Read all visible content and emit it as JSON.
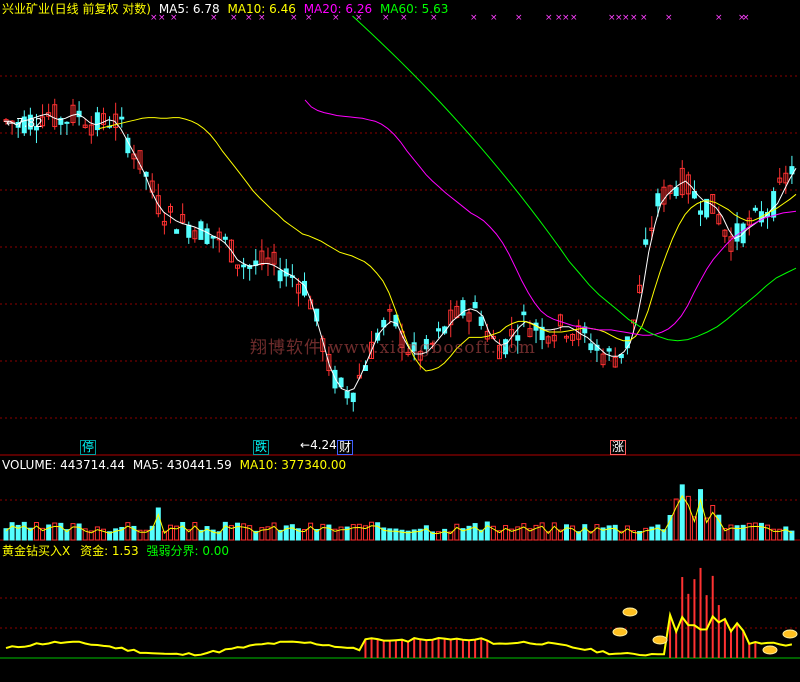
{
  "header": {
    "stock_name": "兴业矿业(日线 前复权 对数)",
    "ma": [
      {
        "text": "MA5: 6.78",
        "color": "#ffffff"
      },
      {
        "text": "MA10: 6.46",
        "color": "#ffff00"
      },
      {
        "text": "MA20: 6.26",
        "color": "#ff00ff"
      },
      {
        "text": "MA60: 5.63",
        "color": "#00ff00"
      }
    ]
  },
  "volume_header": {
    "volume": "VOLUME: 443714.44",
    "ma5": "MA5: 430441.59",
    "ma10": "MA10: 377340.00"
  },
  "indicator_header": {
    "name": "黄金钻买入X",
    "fund": "资金: 1.53",
    "boundary": "强弱分界: 0.00"
  },
  "annotations": {
    "high_label": "7.82",
    "low_label": "4.24",
    "event_ting": "停",
    "event_die": "跌",
    "event_cai": "财",
    "event_zhang": "涨"
  },
  "watermark": "翔博软件 www.xiangbosoft.com",
  "colors": {
    "up": "#ff3232",
    "down": "#54ffff",
    "ma5": "#ffffff",
    "ma10": "#ffff00",
    "ma20": "#ff00ff",
    "ma60": "#00ff00",
    "grid": "#8b0000",
    "indicator": "#ffff00",
    "boundary": "#00c000"
  },
  "chart_data": {
    "type": "candlestick",
    "scale": "log",
    "ylim": [
      4.0,
      9.0
    ],
    "series": [
      {
        "name": "MA5",
        "values": [
          7.4,
          7.4,
          7.35,
          7.4,
          7.42,
          7.45,
          7.48,
          7.5,
          7.45,
          7.42,
          7.44,
          7.48,
          7.5,
          7.45,
          7.38,
          7.35,
          7.38,
          7.42,
          7.4,
          7.3,
          7.15,
          7.0,
          6.85,
          6.7,
          6.5,
          6.35,
          6.25,
          6.2,
          6.15,
          6.12,
          6.1,
          6.08,
          6.05,
          6.02,
          5.98,
          5.95,
          5.9,
          5.82,
          5.72,
          5.68,
          5.65,
          5.66,
          5.68,
          5.68,
          5.66,
          5.62,
          5.58,
          5.55,
          5.5,
          5.45,
          5.3,
          5.1,
          4.9,
          4.7,
          4.58,
          4.5,
          4.48,
          4.5,
          4.6,
          4.72,
          4.85,
          4.98,
          5.05,
          5.1,
          5.08,
          4.95,
          4.85,
          4.8,
          4.8,
          4.82,
          4.88,
          4.95,
          5.02,
          5.1,
          5.15,
          5.2,
          5.22,
          5.2,
          5.15,
          5.0,
          4.92,
          4.88,
          4.9,
          4.98,
          5.05,
          5.1,
          5.08,
          5.05,
          5.02,
          5.02,
          5.03,
          5.05,
          5.05,
          5.02,
          4.98,
          4.95,
          4.9,
          4.85,
          4.8,
          4.78,
          4.78,
          4.82,
          4.9,
          5.1,
          5.4,
          5.8,
          6.1,
          6.35,
          6.45,
          6.52,
          6.58,
          6.62,
          6.55,
          6.45,
          6.38,
          6.35,
          6.3,
          6.2,
          6.05,
          5.95,
          5.98,
          6.05,
          6.1,
          6.15,
          6.2,
          6.28,
          6.35,
          6.5,
          6.65,
          6.78
        ]
      },
      {
        "name": "MA10",
        "values": [
          7.3,
          7.32,
          7.34,
          7.36,
          7.38,
          7.4,
          7.42,
          7.44,
          7.45,
          7.45,
          7.44,
          7.44,
          7.45,
          7.45,
          7.43,
          7.4,
          7.36,
          7.3,
          7.22,
          7.12,
          7.0,
          6.9,
          6.8,
          6.7,
          6.6,
          6.5,
          6.42,
          6.35,
          6.28,
          6.22,
          6.15,
          6.1,
          6.05,
          6.0,
          5.98,
          5.95,
          5.92,
          5.88,
          5.84,
          5.8,
          5.78,
          5.76,
          5.73,
          5.7,
          5.65,
          5.58,
          5.5,
          5.38,
          5.22,
          5.05,
          4.9,
          4.78,
          4.7,
          4.65,
          4.66,
          4.68,
          4.72,
          4.78,
          4.85,
          4.9,
          4.95,
          4.95,
          4.95,
          4.96,
          4.98,
          5.0,
          5.05,
          5.08,
          5.1,
          5.1,
          5.08,
          5.05,
          5.02,
          5.0,
          5.0,
          5.0,
          5.01,
          5.02,
          5.03,
          5.04,
          5.03,
          5.02,
          5.0,
          4.97,
          4.94,
          4.92,
          4.92,
          4.96,
          5.05,
          5.2,
          5.4,
          5.6,
          5.78,
          5.95,
          6.1,
          6.22,
          6.3,
          6.35,
          6.38,
          6.38,
          6.36,
          6.32,
          6.28,
          6.22,
          6.18,
          6.15,
          6.15,
          6.18,
          6.22,
          6.26,
          6.3,
          6.35,
          6.4,
          6.46
        ]
      },
      {
        "name": "MA20",
        "values": [
          7.7,
          7.6,
          7.55,
          7.52,
          7.5,
          7.48,
          7.47,
          7.46,
          7.45,
          7.44,
          7.42,
          7.4,
          7.36,
          7.3,
          7.22,
          7.12,
          7.0,
          6.9,
          6.8,
          6.7,
          6.62,
          6.55,
          6.48,
          6.42,
          6.36,
          6.3,
          6.24,
          6.2,
          6.15,
          6.08,
          6.0,
          5.9,
          5.78,
          5.64,
          5.5,
          5.38,
          5.28,
          5.2,
          5.15,
          5.12,
          5.1,
          5.08,
          5.06,
          5.05,
          5.04,
          5.03,
          5.02,
          5.02,
          5.02,
          5.01,
          5.0,
          4.99,
          4.98,
          4.97,
          4.97,
          4.98,
          5.0,
          5.03,
          5.08,
          5.15,
          5.25,
          5.38,
          5.5,
          5.62,
          5.72,
          5.8,
          5.88,
          5.95,
          6.0,
          6.05,
          6.1,
          6.14,
          6.18,
          6.2,
          6.22,
          6.24,
          6.25,
          6.26
        ]
      },
      {
        "name": "MA60",
        "values": [
          9.0,
          8.85,
          8.7,
          8.55,
          8.4,
          8.25,
          8.1,
          7.95,
          7.8,
          7.65,
          7.5,
          7.35,
          7.2,
          7.05,
          6.9,
          6.75,
          6.6,
          6.45,
          6.3,
          6.15,
          6.0,
          5.85,
          5.7,
          5.58,
          5.46,
          5.36,
          5.28,
          5.2,
          5.12,
          5.06,
          5.0,
          4.96,
          4.93,
          4.92,
          4.93,
          4.96,
          5.0,
          5.05,
          5.12,
          5.2,
          5.28,
          5.36,
          5.45,
          5.53,
          5.58,
          5.63
        ]
      }
    ],
    "volume": {
      "values": [
        443714.44
      ],
      "ma5": 430441.59,
      "ma10": 377340.0
    },
    "indicator": {
      "fund": 1.53,
      "boundary": 0.0
    }
  }
}
